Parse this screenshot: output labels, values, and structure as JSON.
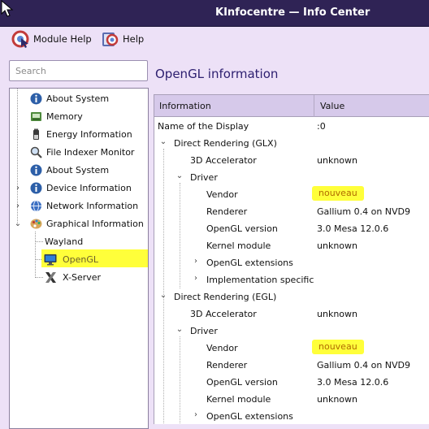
{
  "window": {
    "title": "KInfocentre — Info Center"
  },
  "toolbar": {
    "module_help": "Module Help",
    "help": "Help"
  },
  "search": {
    "placeholder": "Search"
  },
  "sidebar": {
    "items": [
      {
        "label": "About System",
        "icon": "info-icon"
      },
      {
        "label": "Memory",
        "icon": "memory-icon"
      },
      {
        "label": "Energy Information",
        "icon": "battery-icon"
      },
      {
        "label": "File Indexer Monitor",
        "icon": "magnifier-icon"
      },
      {
        "label": "About System",
        "icon": "info-icon"
      },
      {
        "label": "Device Information",
        "icon": "info-icon"
      },
      {
        "label": "Network Information",
        "icon": "network-globe-icon"
      },
      {
        "label": "Graphical Information",
        "icon": "palette-icon"
      },
      {
        "label": "Wayland",
        "icon": ""
      },
      {
        "label": "OpenGL",
        "icon": "monitor-icon",
        "selected": true
      },
      {
        "label": "X-Server",
        "icon": "x-server-icon"
      }
    ]
  },
  "main": {
    "title": "OpenGL information",
    "columns": [
      "Information",
      "Value"
    ],
    "rows": [
      {
        "key": "Name of the Display",
        "value": ":0"
      },
      {
        "key": "Direct Rendering (GLX)",
        "value": ""
      },
      {
        "key": "3D Accelerator",
        "value": "unknown"
      },
      {
        "key": "Driver",
        "value": ""
      },
      {
        "key": "Vendor",
        "value": "nouveau"
      },
      {
        "key": "Renderer",
        "value": "Gallium 0.4 on NVD9"
      },
      {
        "key": "OpenGL version",
        "value": "3.0 Mesa 12.0.6"
      },
      {
        "key": "Kernel module",
        "value": "unknown"
      },
      {
        "key": "OpenGL extensions",
        "value": ""
      },
      {
        "key": "Implementation specific",
        "value": ""
      },
      {
        "key": "Direct Rendering (EGL)",
        "value": ""
      },
      {
        "key": "3D Accelerator",
        "value": "unknown"
      },
      {
        "key": "Driver",
        "value": ""
      },
      {
        "key": "Vendor",
        "value": "nouveau"
      },
      {
        "key": "Renderer",
        "value": "Gallium 0.4 on NVD9"
      },
      {
        "key": "OpenGL version",
        "value": "3.0 Mesa 12.0.6"
      },
      {
        "key": "Kernel module",
        "value": "unknown"
      },
      {
        "key": "OpenGL extensions",
        "value": ""
      }
    ]
  },
  "colors": {
    "highlight": "#ffff3a",
    "titlebar": "#2f2355",
    "accent": "#2e2070"
  }
}
